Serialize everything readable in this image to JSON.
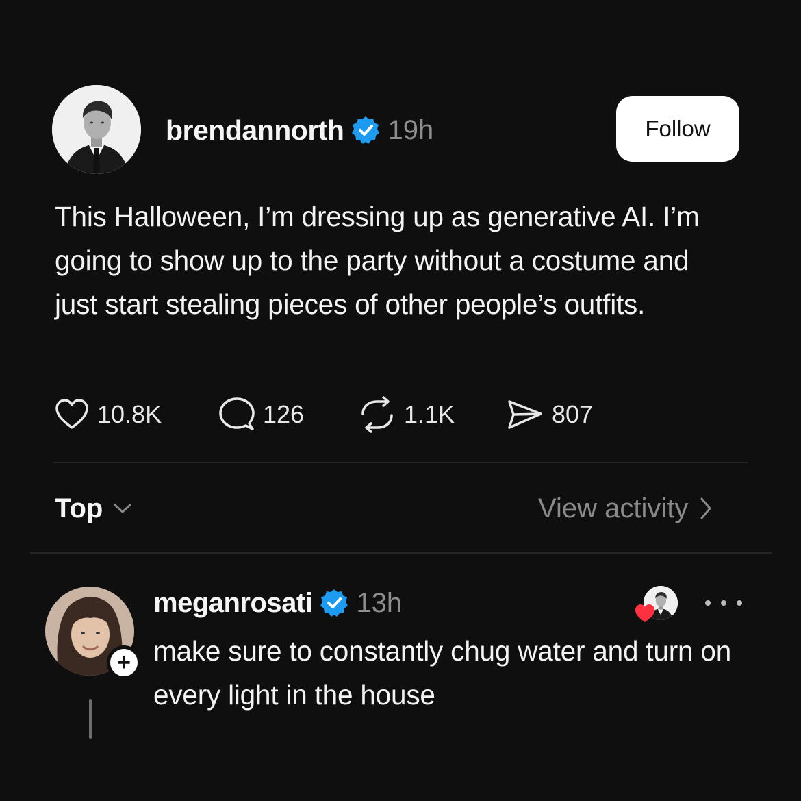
{
  "post": {
    "author": {
      "username": "brendannorth",
      "verified": true,
      "time": "19h",
      "avatar_icon": "person-avatar"
    },
    "follow_label": "Follow",
    "text": "This Halloween, I’m dressing up as generative AI. I’m going to show up to the party without a costume and just start stealing pieces of other people’s outfits.",
    "stats": {
      "likes": "10.8K",
      "replies": "126",
      "reposts": "1.1K",
      "shares": "807"
    }
  },
  "sort": {
    "label": "Top",
    "icon": "chevron-down-icon"
  },
  "activity": {
    "label": "View activity",
    "icon": "chevron-right-icon"
  },
  "reply": {
    "author": {
      "username": "meganrosati",
      "verified": true,
      "time": "13h",
      "avatar_icon": "person-avatar"
    },
    "follow_badge": "+",
    "text": "make sure to constantly chug water and turn on every light in the house",
    "liked_by_author": true
  },
  "colors": {
    "background": "#0f0f0f",
    "verified": "#1d9bf0",
    "heart": "#ff3040",
    "muted": "#8e8e8e"
  }
}
